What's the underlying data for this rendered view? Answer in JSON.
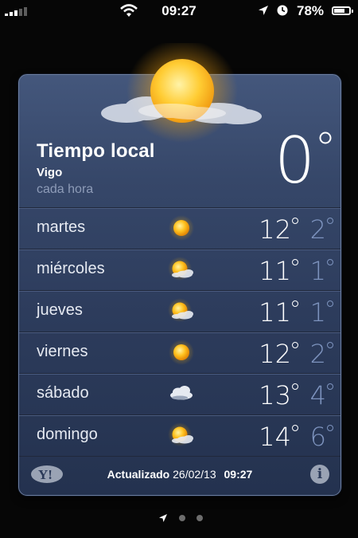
{
  "status_bar": {
    "time": "09:27",
    "battery_percent": "78%",
    "battery_level": 0.78
  },
  "widget": {
    "title": "Tiempo local",
    "city": "Vigo",
    "subtitle": "cada hora",
    "current_temp": "0",
    "current_condition_icon": "sun-behind-cloud-icon",
    "forecast": [
      {
        "day": "martes",
        "icon": "sun-icon",
        "high": "12",
        "low": "2"
      },
      {
        "day": "miércoles",
        "icon": "partly-cloudy-icon",
        "high": "11",
        "low": "1"
      },
      {
        "day": "jueves",
        "icon": "partly-cloudy-icon",
        "high": "11",
        "low": "1"
      },
      {
        "day": "viernes",
        "icon": "sun-icon",
        "high": "12",
        "low": "2"
      },
      {
        "day": "sábado",
        "icon": "cloud-icon",
        "high": "13",
        "low": "4"
      },
      {
        "day": "domingo",
        "icon": "partly-cloudy-icon",
        "high": "14",
        "low": "6"
      }
    ],
    "footer": {
      "updated_label": "Actualizado",
      "updated_date": "26/02/13",
      "updated_time": "09:27",
      "logo": "Y!"
    }
  },
  "pager": {
    "pages": 3,
    "current": 0
  },
  "colors": {
    "card_top": "#44577c",
    "card_bottom": "#24324f",
    "low_temp": "#7d93be"
  }
}
